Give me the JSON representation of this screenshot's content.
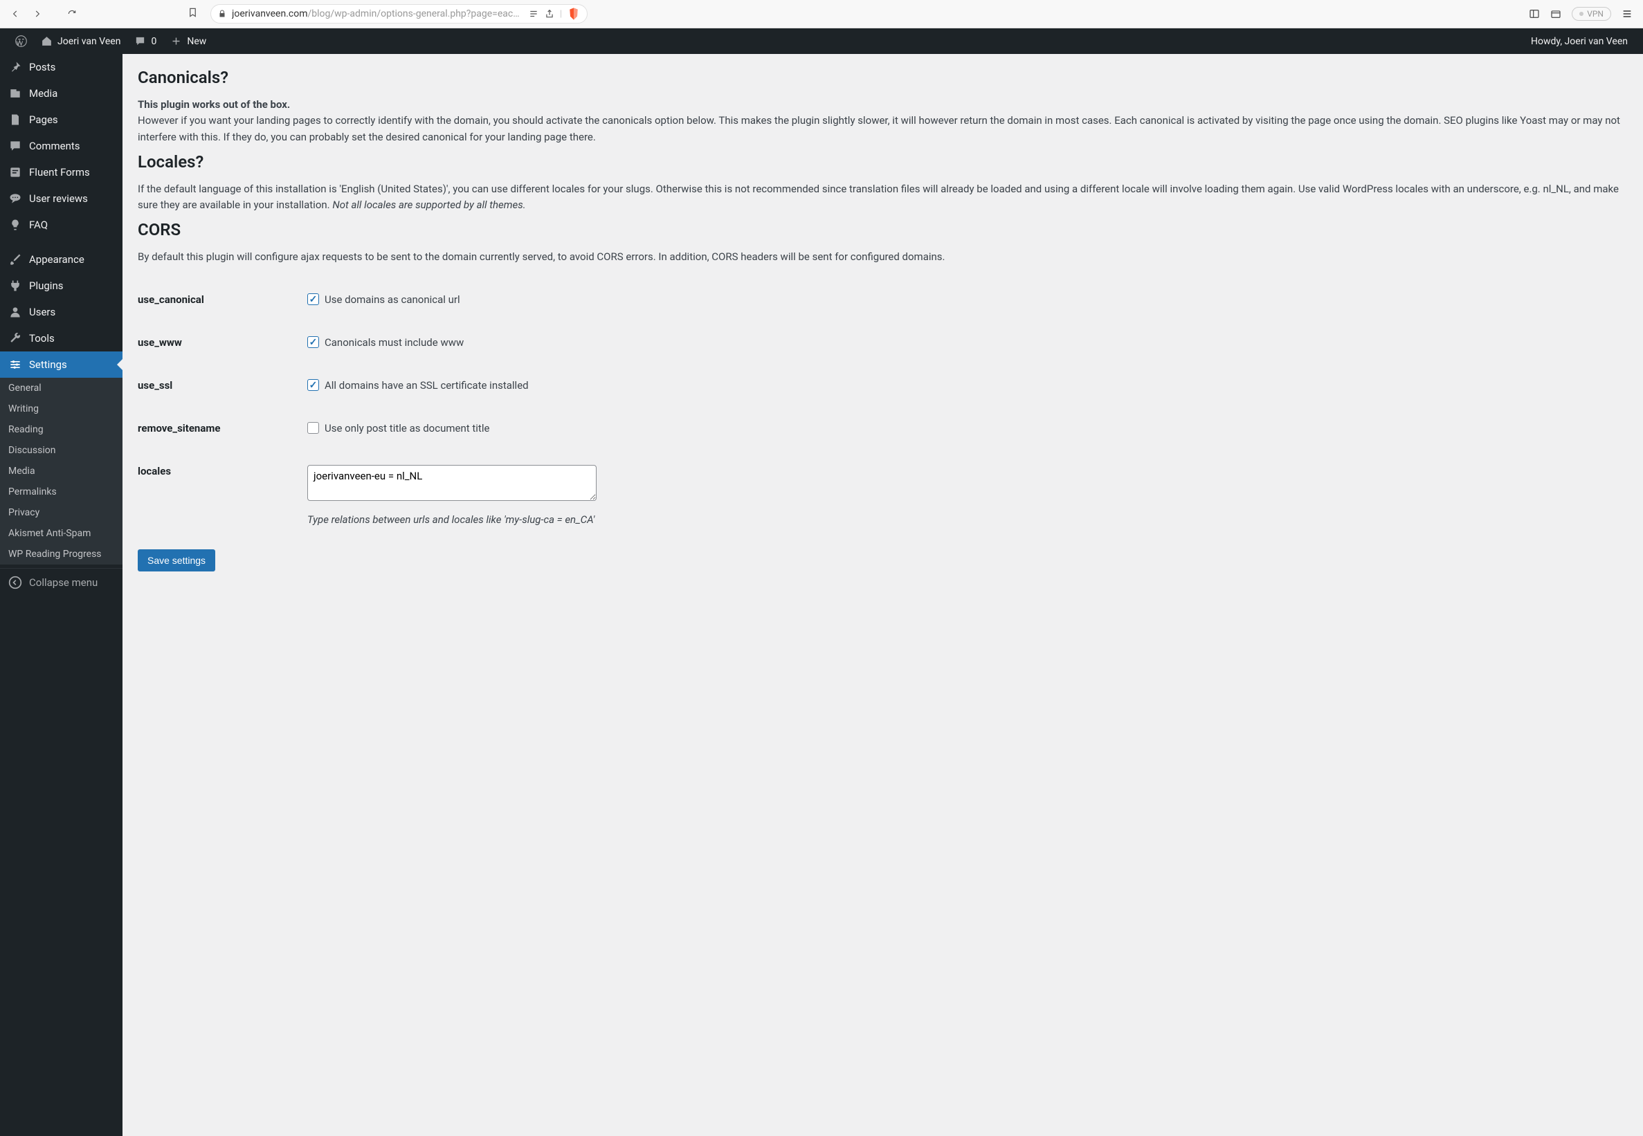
{
  "browser": {
    "url_domain": "joerivanveen.com",
    "url_path": "/blog/wp-admin/options-general.php?page=each-…",
    "vpn_label": "VPN"
  },
  "adminbar": {
    "site_name": "Joeri van Veen",
    "comment_count": "0",
    "new_label": "New",
    "greeting": "Howdy, Joeri van Veen"
  },
  "sidebar": {
    "items": [
      {
        "label": "Posts"
      },
      {
        "label": "Media"
      },
      {
        "label": "Pages"
      },
      {
        "label": "Comments"
      },
      {
        "label": "Fluent Forms"
      },
      {
        "label": "User reviews"
      },
      {
        "label": "FAQ"
      },
      {
        "label": "Appearance"
      },
      {
        "label": "Plugins"
      },
      {
        "label": "Users"
      },
      {
        "label": "Tools"
      },
      {
        "label": "Settings"
      }
    ],
    "submenu": [
      {
        "label": "General"
      },
      {
        "label": "Writing"
      },
      {
        "label": "Reading"
      },
      {
        "label": "Discussion"
      },
      {
        "label": "Media"
      },
      {
        "label": "Permalinks"
      },
      {
        "label": "Privacy"
      },
      {
        "label": "Akismet Anti-Spam"
      },
      {
        "label": "WP Reading Progress"
      }
    ],
    "collapse_label": "Collapse menu"
  },
  "content": {
    "canonicals": {
      "heading": "Canonicals?",
      "intro_bold": "This plugin works out of the box.",
      "intro_rest": "However if you want your landing pages to correctly identify with the domain, you should activate the canonicals option below. This makes the plugin slightly slower, it will however return the domain in most cases. Each canonical is activated by visiting the page once using the domain. SEO plugins like Yoast may or may not interfere with this. If they do, you can probably set the desired canonical for your landing page there."
    },
    "locales": {
      "heading": "Locales?",
      "text_plain": "If the default language of this installation is 'English (United States)', you can use different locales for your slugs. Otherwise this is not recommended since translation files will already be loaded and using a different locale will involve loading them again. Use valid WordPress locales with an underscore, e.g. nl_NL, and make sure they are available in your installation. ",
      "text_em": "Not all locales are supported by all themes."
    },
    "cors": {
      "heading": "CORS",
      "text": "By default this plugin will configure ajax requests to be sent to the domain currently served, to avoid CORS errors. In addition, CORS headers will be sent for configured domains."
    },
    "fields": {
      "use_canonical": {
        "label": "use_canonical",
        "text": "Use domains as canonical url",
        "checked": true
      },
      "use_www": {
        "label": "use_www",
        "text": "Canonicals must include www",
        "checked": true
      },
      "use_ssl": {
        "label": "use_ssl",
        "text": "All domains have an SSL certificate installed",
        "checked": true
      },
      "remove_sitename": {
        "label": "remove_sitename",
        "text": "Use only post title as document title",
        "checked": false
      },
      "locales_field": {
        "label": "locales",
        "value": "joerivanveen-eu = nl_NL",
        "hint": "Type relations between urls and locales like 'my-slug-ca = en_CA'"
      }
    },
    "save_label": "Save settings"
  }
}
